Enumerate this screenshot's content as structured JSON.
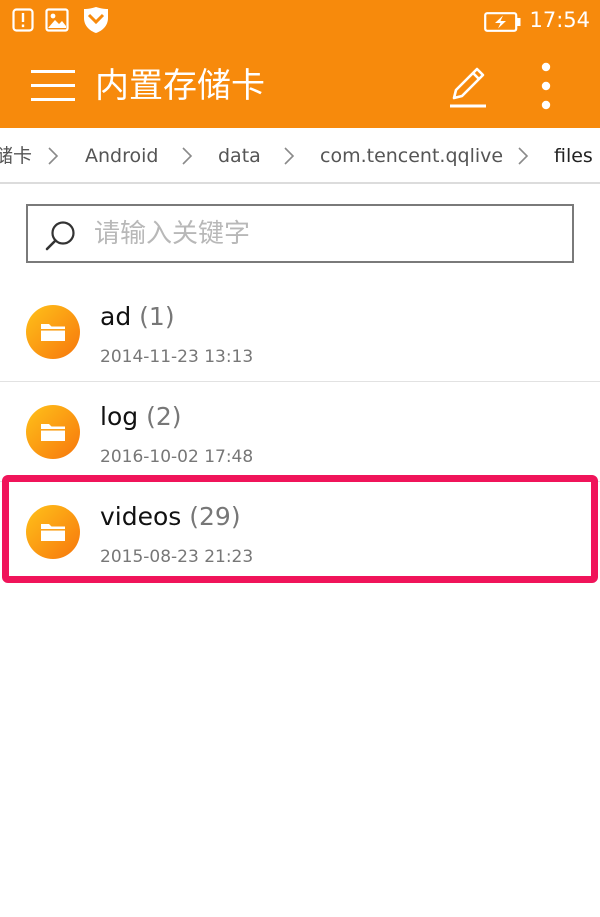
{
  "status_bar": {
    "time": "17:54",
    "left_icons": [
      "alert-icon",
      "image-icon",
      "shield-icon"
    ],
    "right_icons": [
      "battery-charging-icon"
    ]
  },
  "app_bar": {
    "title": "内置存储卡",
    "icons": [
      "menu-icon",
      "edit-icon",
      "more-vert-icon"
    ],
    "color": "#F78A0C"
  },
  "breadcrumb": {
    "items": [
      "储卡",
      "Android",
      "data",
      "com.tencent.qqlive",
      "files"
    ]
  },
  "search": {
    "placeholder": "请输入关键字",
    "value": ""
  },
  "files": [
    {
      "name": "ad",
      "count": "(1)",
      "date": "2014-11-23 13:13"
    },
    {
      "name": "log",
      "count": "(2)",
      "date": "2016-10-02 17:48"
    },
    {
      "name": "videos",
      "count": "(29)",
      "date": "2015-08-23 21:23"
    }
  ],
  "colors": {
    "accent": "#F78A0C",
    "highlight": "#F0145A",
    "folder_gradient": [
      "#FFC21A",
      "#F7760C"
    ]
  }
}
